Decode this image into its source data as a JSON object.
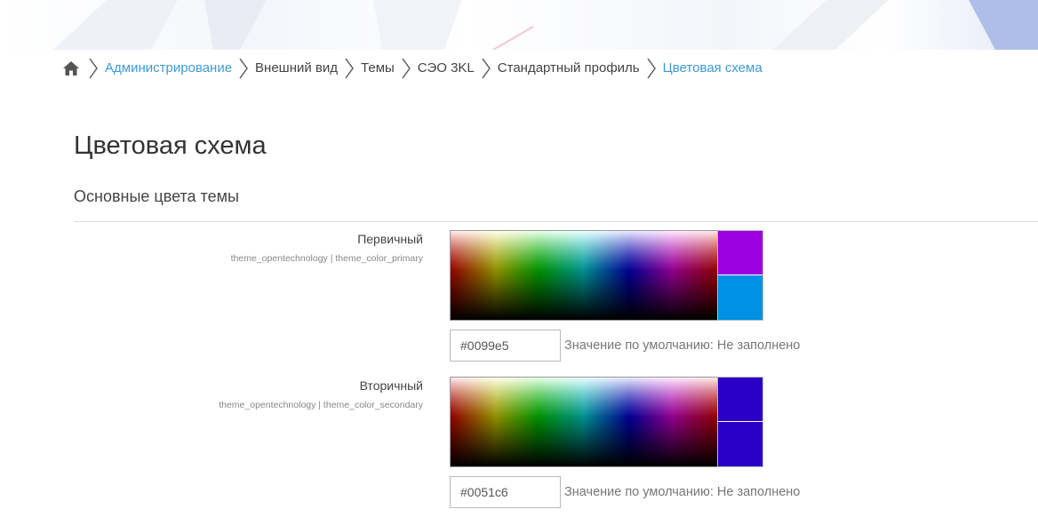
{
  "breadcrumb": {
    "items": [
      {
        "label": "Администрирование",
        "kind": "link"
      },
      {
        "label": "Внешний вид",
        "kind": "plain"
      },
      {
        "label": "Темы",
        "kind": "plain"
      },
      {
        "label": "СЭО 3KL",
        "kind": "plain"
      },
      {
        "label": "Стандартный профиль",
        "kind": "plain"
      },
      {
        "label": "Цветовая схема",
        "kind": "link"
      }
    ],
    "home_icon": "home-icon",
    "separator_icon": "chevron-right-icon"
  },
  "page": {
    "title": "Цветовая схема",
    "section_title": "Основные цвета темы"
  },
  "settings": [
    {
      "label": "Первичный",
      "sublabel": "theme_opentechnology | theme_color_primary",
      "value": "#0099e5",
      "default_note": "Значение по умолчанию: Не заполнено",
      "swatch_top": "#9b00e0",
      "swatch_bottom": "#0090e5"
    },
    {
      "label": "Вторичный",
      "sublabel": "theme_opentechnology | theme_color_secondary",
      "value": "#0051c6",
      "default_note": "Значение по умолчанию: Не заполнено",
      "swatch_top": "#2a00c6",
      "swatch_bottom": "#2a00c6"
    }
  ],
  "colors": {
    "link": "#3f9ad6",
    "text": "#333333"
  }
}
